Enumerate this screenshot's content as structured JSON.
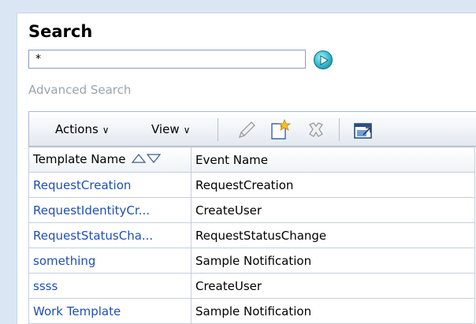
{
  "search": {
    "title": "Search",
    "query_value": "*",
    "advanced_link": "Advanced Search"
  },
  "toolbar": {
    "actions_label": "Actions",
    "view_label": "View",
    "icons": [
      "edit-icon",
      "create-icon",
      "delete-icon",
      "detach-icon"
    ]
  },
  "table": {
    "columns": [
      "Template Name",
      "Event Name"
    ],
    "rows": [
      {
        "template": "RequestCreation",
        "event": "RequestCreation"
      },
      {
        "template": "RequestIdentityCr...",
        "event": "CreateUser"
      },
      {
        "template": "RequestStatusCha...",
        "event": "RequestStatusChange"
      },
      {
        "template": "something",
        "event": "Sample Notification"
      },
      {
        "template": "ssss",
        "event": "CreateUser"
      },
      {
        "template": "Work Template",
        "event": "Sample Notification"
      }
    ]
  },
  "colors": {
    "link": "#1f4fb0",
    "page_background": "#dbe6f4",
    "go_button": "#3ec3d5"
  }
}
